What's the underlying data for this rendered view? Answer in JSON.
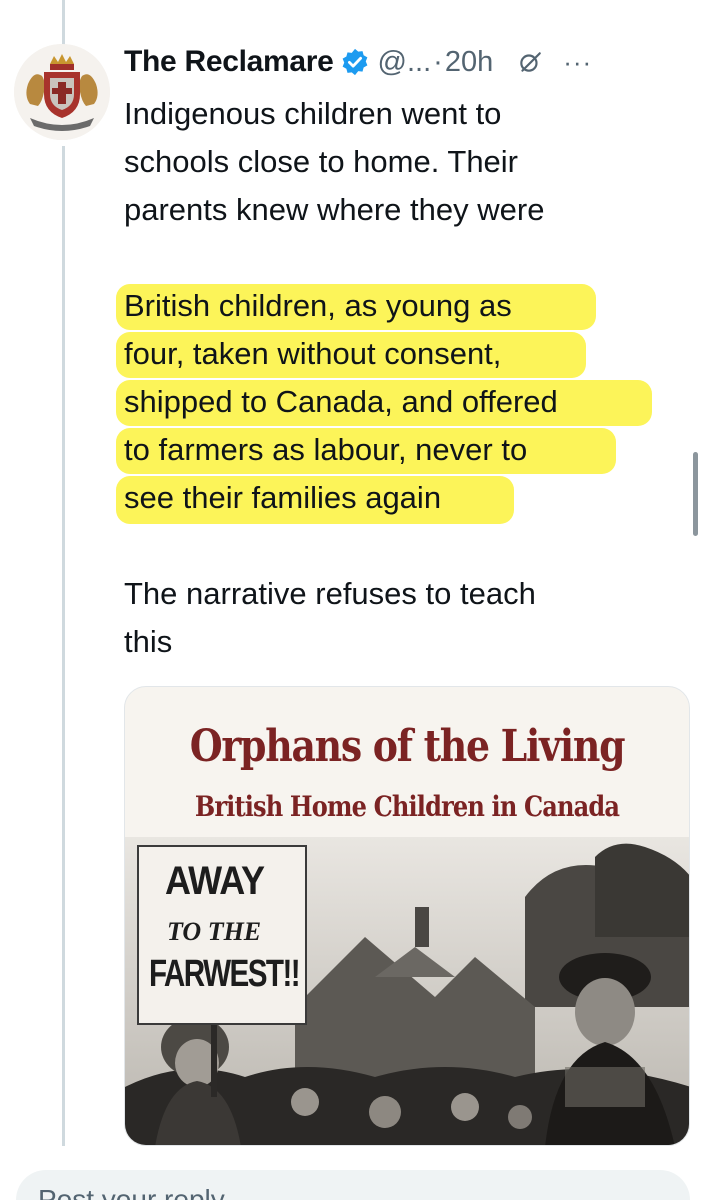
{
  "tweet": {
    "author_name": "The Reclamare",
    "handle": "@...",
    "separator": "·",
    "time": "20h",
    "verified_color": "#1d9bf0",
    "icons": [
      "grok-icon",
      "more-icon"
    ],
    "more_label": "···",
    "paragraph_1": [
      "Indigenous children went to",
      "schools close to home. Their",
      "parents knew where they were"
    ],
    "paragraph_2": [
      "British children, as young as",
      "four, taken without consent,",
      "shipped to Canada, and offered",
      "to farmers as labour, never to",
      "see their families again"
    ],
    "paragraph_3": [
      "The narrative refuses to teach",
      "this"
    ],
    "highlight_color": "#fbf23c"
  },
  "media": {
    "title": "Orphans of the Living",
    "subtitle": "British Home Children in Canada",
    "sign_line1": "AWAY",
    "sign_line2": "TO THE",
    "sign_line3": "FARWEST!!",
    "title_color": "#7b2323"
  },
  "reply": {
    "placeholder": "Post your reply"
  }
}
